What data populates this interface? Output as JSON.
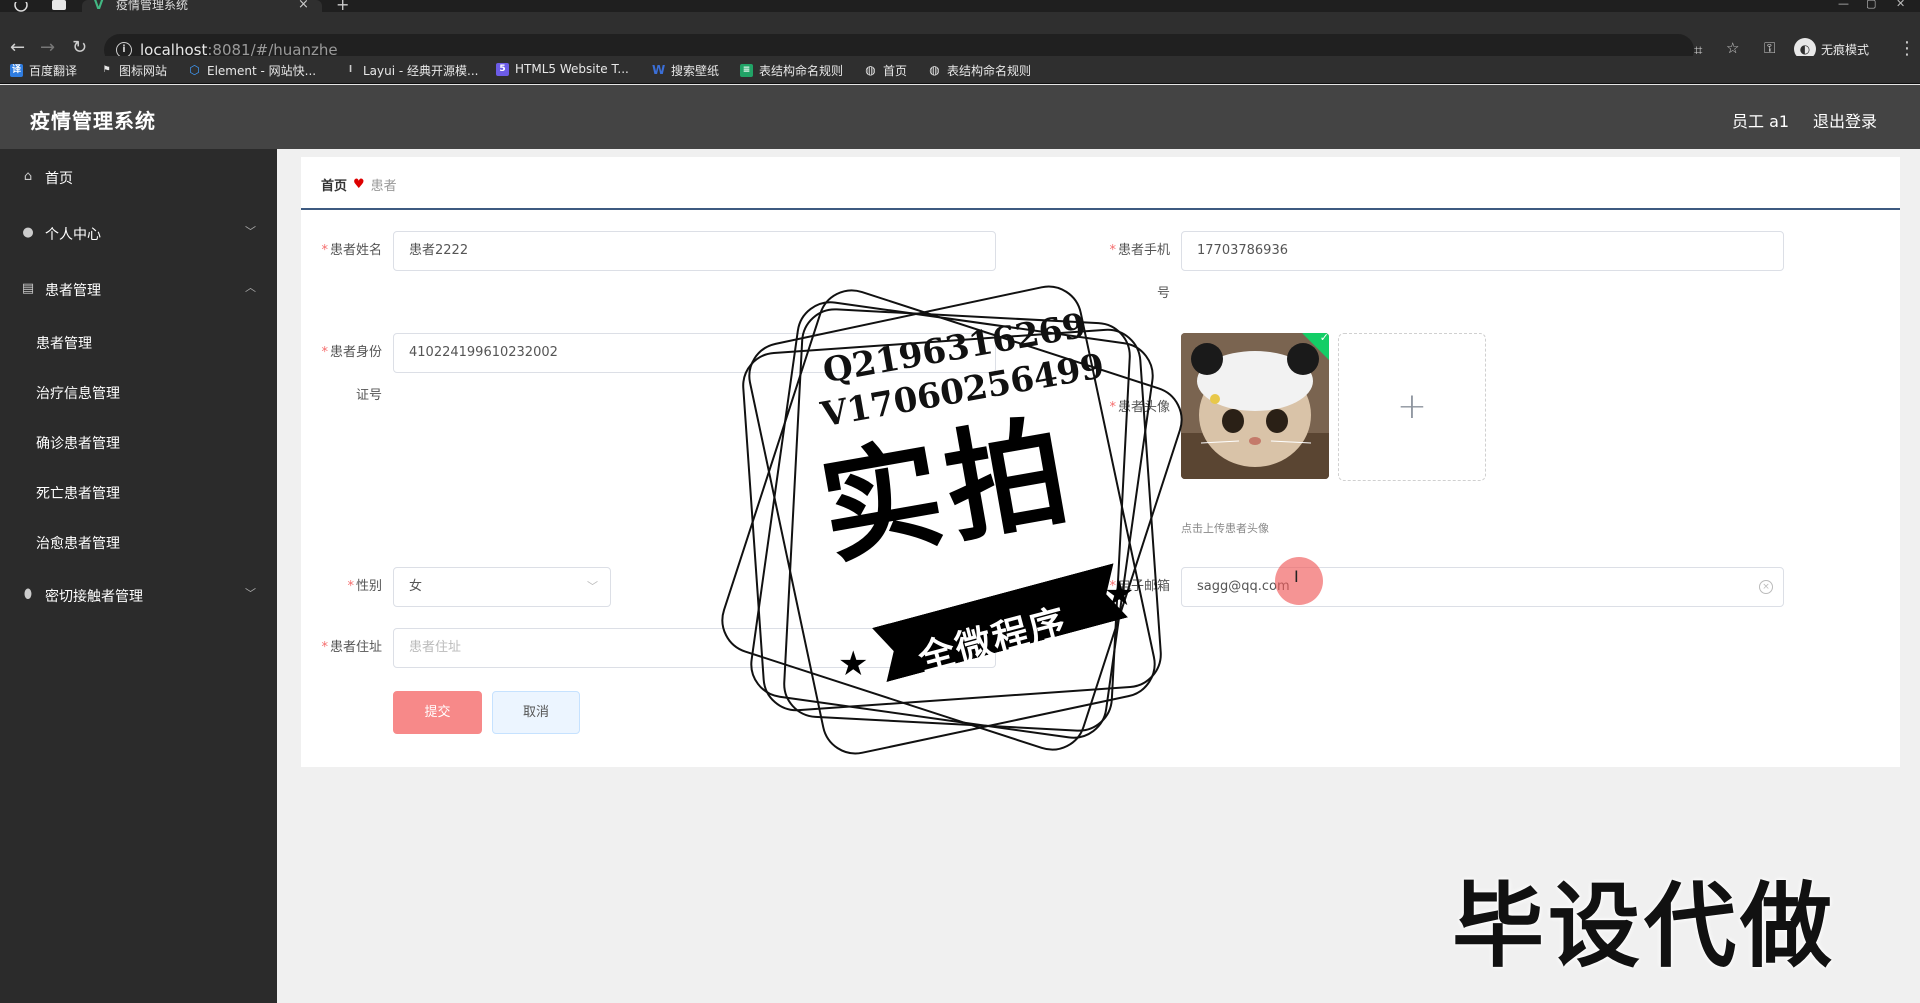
{
  "browser": {
    "tab_title": "疫情管理系统",
    "tab_close": "×",
    "tab_new": "+",
    "url_host": "localhost",
    "url_rest": ":8081/#/huanzhe",
    "profile_label": "无痕模式",
    "bookmarks": [
      {
        "label": "百度翻译",
        "icon": "baidu-translate-icon",
        "color": "#2f7de1"
      },
      {
        "label": "图标网站",
        "icon": "flag-icon",
        "color": "#e8e8e8"
      },
      {
        "label": "Element - 网站快...",
        "icon": "element-icon",
        "color": "#409eff"
      },
      {
        "label": "Layui - 经典开源模...",
        "icon": "layui-icon",
        "color": "#aaaaaa"
      },
      {
        "label": "HTML5 Website T...",
        "icon": "html5-template-icon",
        "color": "#6c5ce7"
      },
      {
        "label": "搜索壁纸",
        "icon": "wallpaper-icon",
        "color": "#3b6fd8"
      },
      {
        "label": "表结构命名规则",
        "icon": "sheet-icon",
        "color": "#21a366"
      },
      {
        "label": "首页",
        "icon": "globe-icon",
        "color": "#e8e8e8"
      },
      {
        "label": "表结构命名规则",
        "icon": "globe-icon",
        "color": "#e8e8e8"
      }
    ]
  },
  "header": {
    "title": "疫情管理系统",
    "user": "员工 a1",
    "logout": "退出登录"
  },
  "sidebar": {
    "items": [
      {
        "label": "首页",
        "icon": "home-icon"
      },
      {
        "label": "个人中心",
        "icon": "user-icon"
      },
      {
        "label": "患者管理",
        "icon": "clipboard-icon"
      },
      {
        "label": "密切接触者管理",
        "icon": "location-pin-icon"
      }
    ],
    "sub_items": [
      "患者管理",
      "治疗信息管理",
      "确诊患者管理",
      "死亡患者管理",
      "治愈患者管理"
    ]
  },
  "breadcrumb": {
    "home": "首页",
    "current": "患者"
  },
  "form": {
    "name_label": "患者姓名",
    "name_value": "患者2222",
    "phone_label": "患者手机",
    "phone_label_wrap": "号",
    "phone_value": "17703786936",
    "idcard_label": "患者身份",
    "idcard_label_wrap": "证号",
    "idcard_value": "410224199610232002",
    "avatar_label": "患者头像",
    "upload_plus": "+",
    "upload_tip": "点击上传患者头像",
    "gender_label": "性别",
    "gender_value": "女",
    "email_label": "电子邮箱",
    "email_value": "sagg@qq.com",
    "address_label": "患者住址",
    "address_placeholder": "患者住址",
    "submit": "提交",
    "cancel": "取消"
  },
  "watermark": {
    "line1": "Q2196316269",
    "line2": "V17060256499",
    "big": "实拍",
    "ribbon": "全微程序",
    "corner": "毕设代做"
  },
  "colors": {
    "header_bg": "#444444",
    "sidebar_bg": "#2b2b2b",
    "submit_bg": "#f78989",
    "cancel_bg": "#ecf5ff",
    "required": "#f56c6c",
    "breadcrumb_line": "#3d5a80",
    "success": "#13ce66"
  }
}
